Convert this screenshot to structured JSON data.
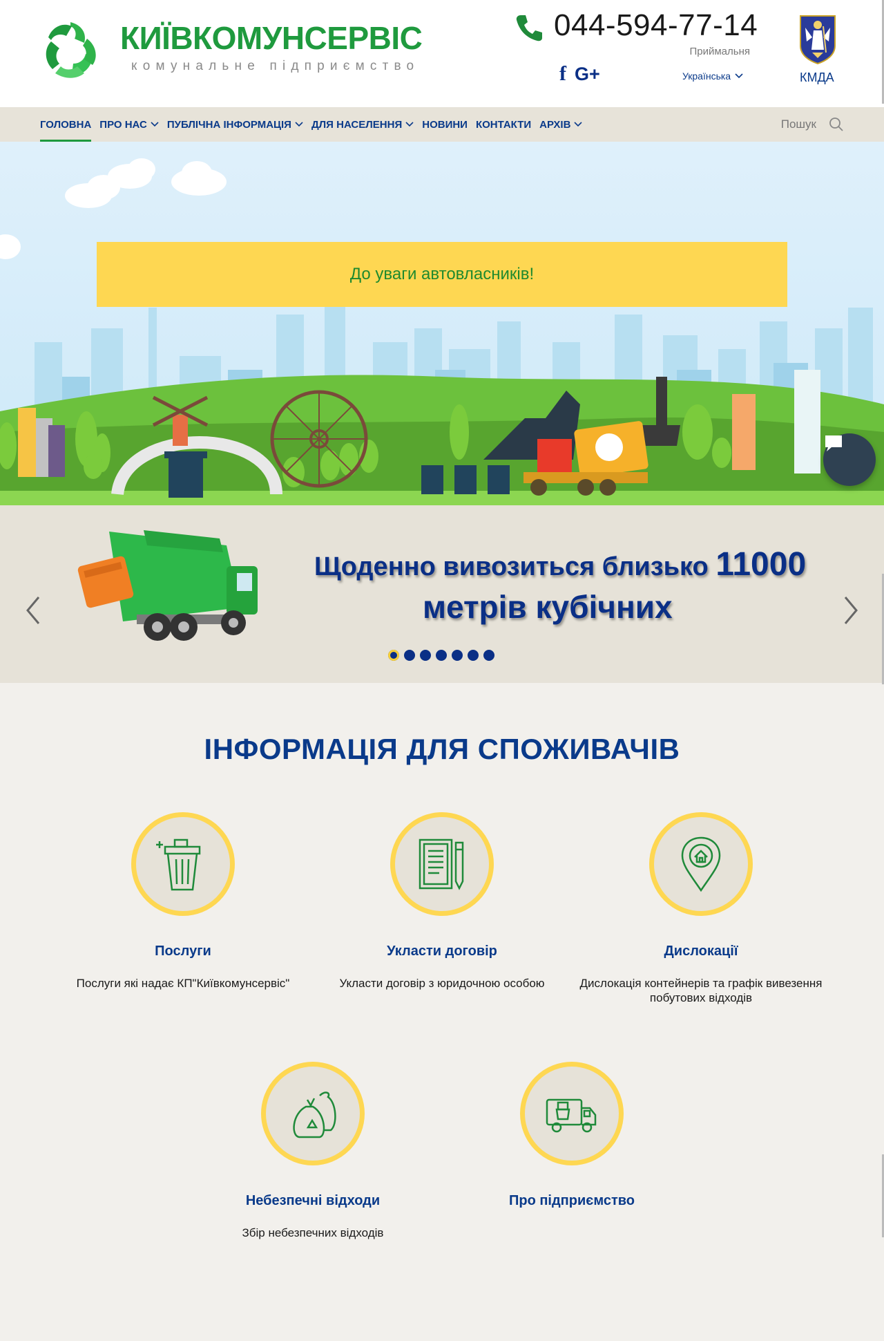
{
  "header": {
    "logo_title": "КИЇВКОМУНСЕРВІС",
    "logo_subtitle": "комунальне підприємство",
    "phone": "044-594-77-14",
    "phone_label": "Приймальня",
    "social": {
      "facebook": "f",
      "gplus": "G+"
    },
    "language": "Українська",
    "kmda_label": "КМДА"
  },
  "nav": {
    "items": [
      {
        "label": "ГОЛОВНА",
        "active": true,
        "dropdown": false
      },
      {
        "label": "ПРО НАС",
        "active": false,
        "dropdown": true
      },
      {
        "label": "ПУБЛІЧНА ІНФОРМАЦІЯ",
        "active": false,
        "dropdown": true
      },
      {
        "label": "ДЛЯ НАСЕЛЕННЯ",
        "active": false,
        "dropdown": true
      },
      {
        "label": "НОВИНИ",
        "active": false,
        "dropdown": false
      },
      {
        "label": "КОНТАКТИ",
        "active": false,
        "dropdown": false
      },
      {
        "label": "АРХІВ",
        "active": false,
        "dropdown": true
      }
    ],
    "search_label": "Пошук"
  },
  "hero": {
    "notice": "До уваги автовласників!"
  },
  "slider": {
    "text_before": "Щоденно вивозиться близько ",
    "number": "11000",
    "text_line2": "метрів кубічних",
    "slide_count": 7,
    "active_slide": 1
  },
  "info": {
    "title": "ІНФОРМАЦІЯ ДЛЯ СПОЖИВАЧІВ",
    "cards": [
      {
        "title": "Послуги",
        "desc": "Послуги які надає КП\"Київкомунсервіс\"",
        "icon": "trash-bin-icon"
      },
      {
        "title": "Укласти договір",
        "desc": "Укласти договір з юридочною особою",
        "icon": "contract-icon"
      },
      {
        "title": "Дислокації",
        "desc": "Дислокація контейнерів та графік вивезення побутових відходів",
        "icon": "location-pin-icon"
      },
      {
        "title": "Небезпечні відходи",
        "desc": "Збір небезпечних відходів",
        "icon": "waste-bag-icon"
      },
      {
        "title": "Про підприємство",
        "desc": "",
        "icon": "garbage-truck-icon"
      }
    ]
  },
  "colors": {
    "brand_green": "#1f9a3e",
    "brand_blue": "#0a3a8a",
    "accent_yellow": "#fed752",
    "nav_bg": "#e7e3d9",
    "page_bg": "#f2f0ec"
  }
}
